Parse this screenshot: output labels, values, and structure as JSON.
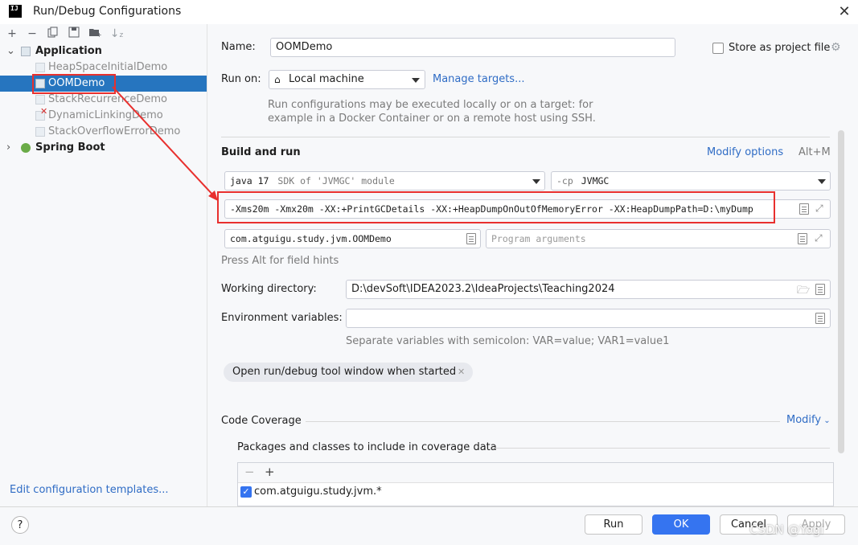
{
  "window": {
    "title": "Run/Debug Configurations",
    "logo_text": "IJ"
  },
  "left": {
    "toolbar_icons": [
      "add-icon",
      "remove-icon",
      "copy-icon",
      "save-icon",
      "new-folder-icon",
      "sort-icon"
    ],
    "tree": {
      "application_label": "Application",
      "items": [
        {
          "label": "HeapSpaceInitialDemo",
          "state": "temporary"
        },
        {
          "label": "OOMDemo",
          "state": "selected"
        },
        {
          "label": "StackRecurrenceDemo",
          "state": "temporary"
        },
        {
          "label": "DynamicLinkingDemo",
          "state": "error"
        },
        {
          "label": "StackOverflowErrorDemo",
          "state": "temporary"
        }
      ],
      "spring_boot_label": "Spring Boot"
    },
    "edit_templates_link": "Edit configuration templates..."
  },
  "form": {
    "name_label": "Name:",
    "name_value": "OOMDemo",
    "store_label": "Store as project file",
    "runon_label": "Run on:",
    "runon_value": "Local machine",
    "manage_targets": "Manage targets...",
    "runon_hint_1": "Run configurations may be executed locally or on a target: for",
    "runon_hint_2": "example in a Docker Container or on a remote host using SSH.",
    "build_run_title": "Build and run",
    "modify_options": "Modify options",
    "modify_shortcut": "Alt+M",
    "jdk_value": "java 17",
    "jdk_hint": "SDK of 'JVMGC' module",
    "cp_prefix": "-cp",
    "cp_value": "JVMGC",
    "vm_options": "-Xms20m -Xmx20m -XX:+PrintGCDetails -XX:+HeapDumpOnOutOfMemoryError -XX:HeapDumpPath=D:\\myDump",
    "main_class": "com.atguigu.study.jvm.OOMDemo",
    "program_args_placeholder": "Program arguments",
    "field_hints": "Press Alt for field hints",
    "workdir_label": "Working directory:",
    "workdir_value": "D:\\devSoft\\IDEA2023.2\\IdeaProjects\\Teaching2024",
    "env_label": "Environment variables:",
    "env_value": "",
    "env_hint": "Separate variables with semicolon: VAR=value; VAR1=value1",
    "open_tool_window_chip": "Open run/debug tool window when started",
    "code_coverage_title": "Code Coverage",
    "modify_label": "Modify",
    "coverage_subtitle": "Packages and classes to include in coverage data",
    "coverage_entry": "com.atguigu.study.jvm.*"
  },
  "buttons": {
    "run": "Run",
    "ok": "OK",
    "cancel": "Cancel",
    "apply": "Apply",
    "help": "?"
  },
  "watermark": "CSDN @Yogi",
  "colors": {
    "selection": "#2675bf",
    "link": "#2f6cc5",
    "primary_button": "#3574f0",
    "annotation_red": "#e8302e"
  }
}
